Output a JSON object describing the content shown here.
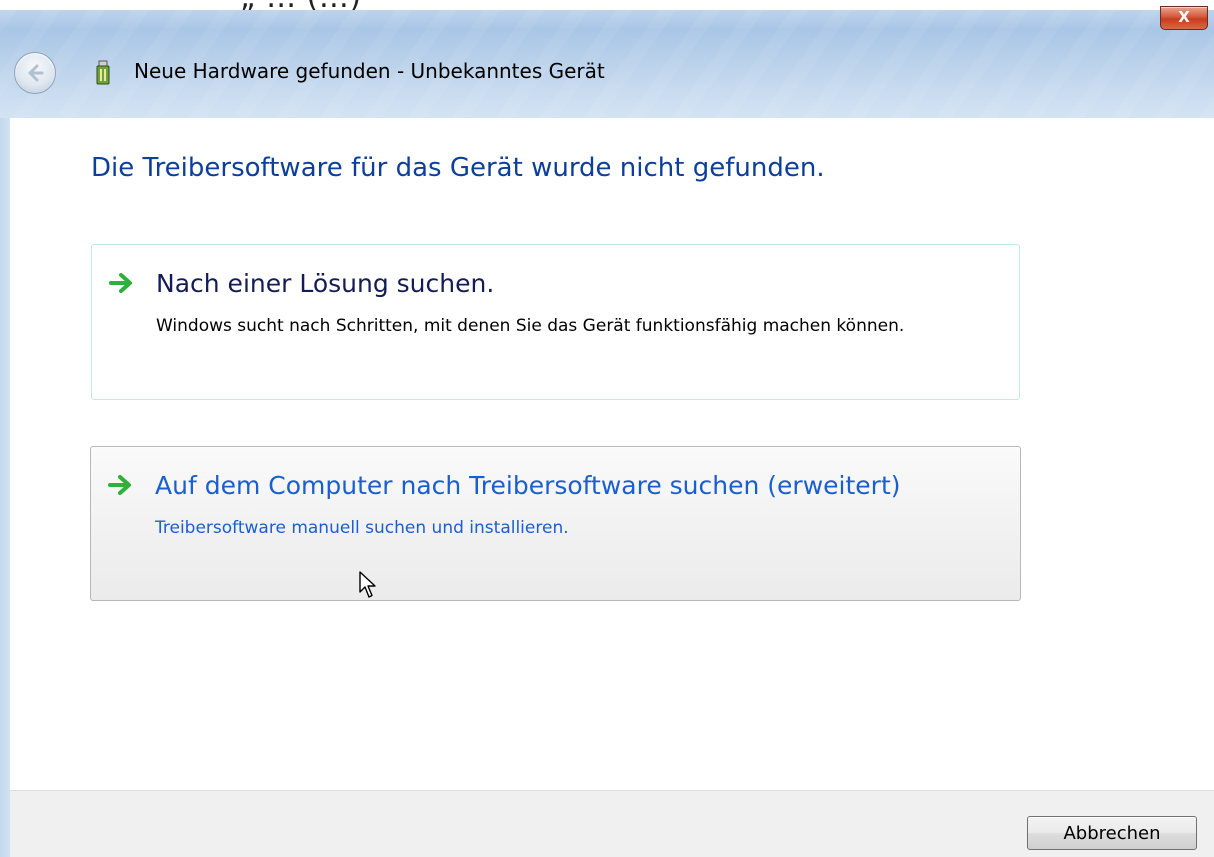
{
  "window": {
    "title": "Neue Hardware gefunden - Unbekanntes Gerät",
    "close_label": "X",
    "top_caption_fragment": "„ … (…)"
  },
  "icons": {
    "back": "back-arrow-icon",
    "device": "hardware-device-icon",
    "close": "close-icon",
    "link_arrow": "green-arrow-icon",
    "cursor": "mouse-pointer-icon"
  },
  "main": {
    "heading": "Die Treibersoftware für das Gerät wurde nicht gefunden.",
    "options": [
      {
        "title": "Nach einer Lösung suchen.",
        "description": "Windows sucht nach Schritten, mit denen Sie das Gerät funktionsfähig machen können."
      },
      {
        "title": "Auf dem Computer nach Treibersoftware suchen (erweitert)",
        "description": "Treibersoftware manuell suchen und installieren."
      }
    ]
  },
  "footer": {
    "cancel_label": "Abbrechen"
  },
  "colors": {
    "heading": "#0d3f9a",
    "link_hover": "#1a5fcf",
    "arrow_green": "#2fb03a",
    "close_red": "#c53d1f"
  }
}
